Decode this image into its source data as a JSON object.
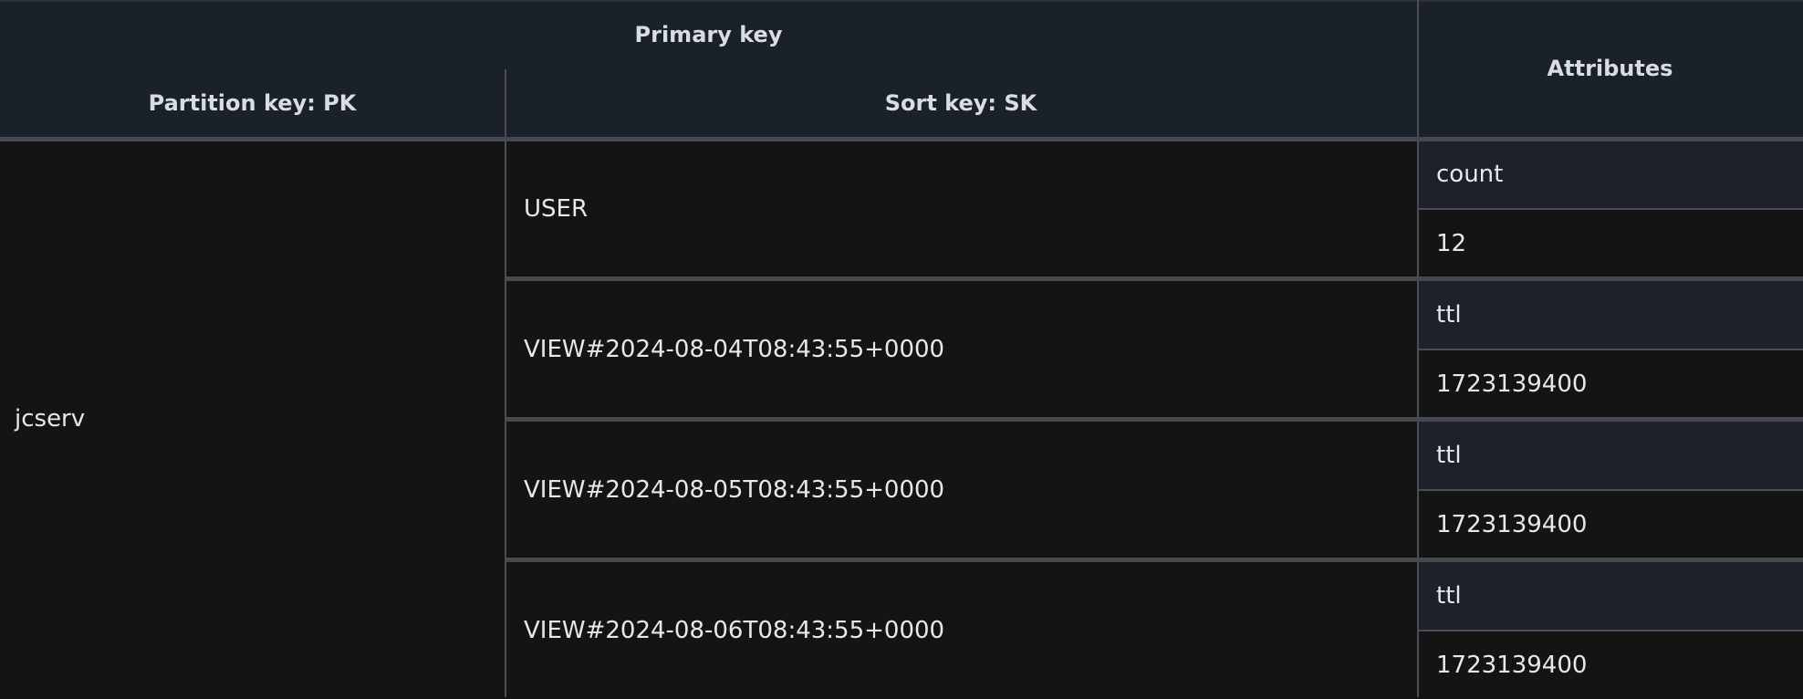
{
  "header": {
    "primary_key": "Primary key",
    "partition_key": "Partition key: PK",
    "sort_key": "Sort key: SK",
    "attributes": "Attributes"
  },
  "partition_value": "jcserv",
  "items": [
    {
      "sort_key": "USER",
      "attr_name": "count",
      "attr_value": "12"
    },
    {
      "sort_key": "VIEW#2024-08-04T08:43:55+0000",
      "attr_name": "ttl",
      "attr_value": "1723139400"
    },
    {
      "sort_key": "VIEW#2024-08-05T08:43:55+0000",
      "attr_name": "ttl",
      "attr_value": "1723139400"
    },
    {
      "sort_key": "VIEW#2024-08-06T08:43:55+0000",
      "attr_name": "ttl",
      "attr_value": "1723139400"
    }
  ]
}
